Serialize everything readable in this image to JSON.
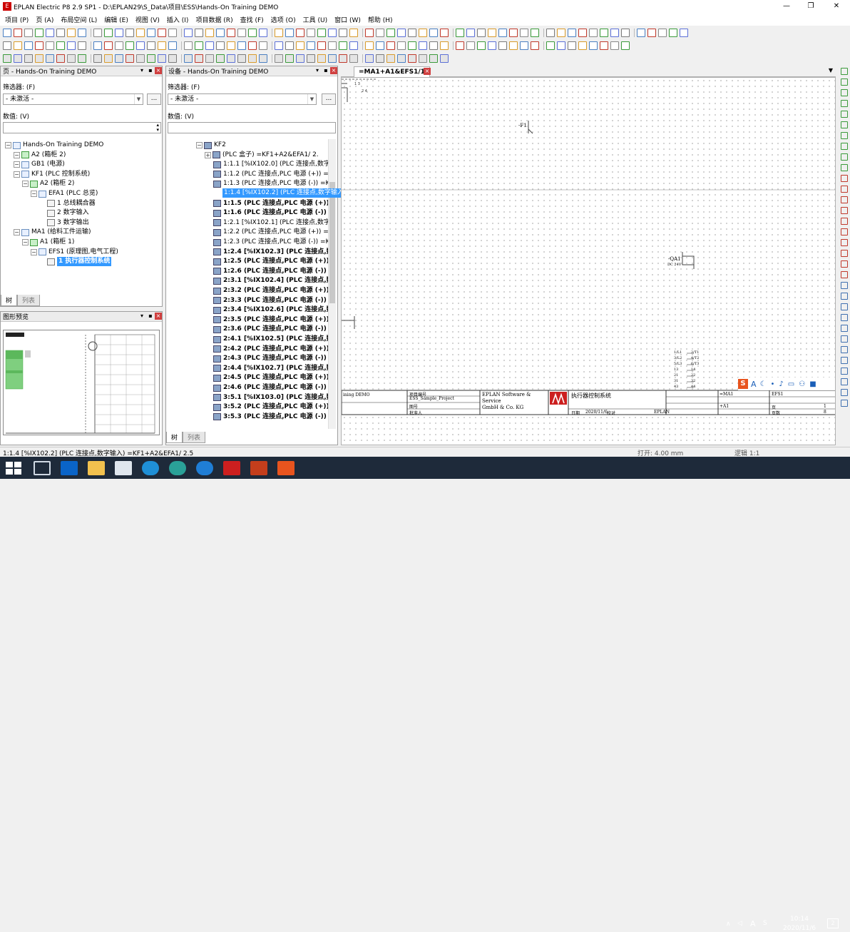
{
  "window": {
    "title": "EPLAN Electric P8 2.9 SP1 - D:\\EPLAN29\\S_Data\\项目\\ESS\\Hands-On Training DEMO",
    "minimize": "—",
    "maximize": "❐",
    "close": "✕"
  },
  "menu": [
    "项目 (P)",
    "页 (A)",
    "布局空间 (L)",
    "编辑 (E)",
    "视图 (V)",
    "插入 (I)",
    "项目数据 (R)",
    "查找 (F)",
    "选项 (O)",
    "工具 (U)",
    "窗口 (W)",
    "帮助 (H)"
  ],
  "page_panel": {
    "title": "页 - Hands-On Training DEMO",
    "filter_label": "筛选器: (F)",
    "filter_value": "- 未激活 -",
    "value_label": "数值: (V)",
    "more_button": "...",
    "tree": [
      {
        "label": "Hands-On Training DEMO",
        "level": 0,
        "icon": "project-icon"
      },
      {
        "label": "A2 (箱柜 2)",
        "level": 1,
        "icon": "cabinet-icon"
      },
      {
        "label": "GB1 (电源)",
        "level": 1,
        "icon": "power-icon"
      },
      {
        "label": "KF1 (PLC 控制系统)",
        "level": 1,
        "icon": "plc-icon"
      },
      {
        "label": "A2 (箱柜 2)",
        "level": 2,
        "icon": "cabinet-icon"
      },
      {
        "label": "EFA1 (PLC 总览)",
        "level": 3,
        "icon": "folder-icon"
      },
      {
        "label": "1 总线耦合器",
        "level": 4,
        "icon": "page-icon"
      },
      {
        "label": "2 数字输入",
        "level": 4,
        "icon": "page-icon"
      },
      {
        "label": "3 数字输出",
        "level": 4,
        "icon": "page-icon"
      },
      {
        "label": "MA1 (给料工件运输)",
        "level": 1,
        "icon": "folder-icon"
      },
      {
        "label": "A1 (箱柜 1)",
        "level": 2,
        "icon": "cabinet-icon"
      },
      {
        "label": "EFS1 (原理图,电气工程)",
        "level": 3,
        "icon": "folder-icon"
      },
      {
        "label": "1 执行器控制系统",
        "level": 4,
        "icon": "page-icon",
        "bold": true,
        "selected": true
      }
    ],
    "tabs": [
      "树",
      "列表"
    ]
  },
  "preview_panel": {
    "title": "图形预览"
  },
  "device_panel": {
    "title": "设备 - Hands-On Training DEMO",
    "filter_label": "筛选器: (F)",
    "filter_value": "- 未激活 -",
    "value_label": "数值: (V)",
    "more_button": "...",
    "tree": [
      {
        "label": "KF2",
        "level": 0,
        "bold": false
      },
      {
        "label": "(PLC 盒子) =KF1+A2&EFA1/ 2.",
        "level": 1
      },
      {
        "label": "1:1.1  [%IX102.0] (PLC 连接点,数字",
        "level": 2
      },
      {
        "label": "1:1.2 (PLC 连接点,PLC 电源 (+)) =I",
        "level": 2
      },
      {
        "label": "1:1.3 (PLC 连接点,PLC 电源 (-)) =K",
        "level": 2
      },
      {
        "label": "1:1.4  [%IX102.2] (PLC 连接点,数字输入) =KF1+A2&EFA1/ 2.5",
        "level": 2,
        "selected": true
      },
      {
        "label": "1:1.5 (PLC 连接点,PLC 电源 (+)) =",
        "level": 2,
        "bold": true
      },
      {
        "label": "1:1.6 (PLC 连接点,PLC 电源 (-)) =",
        "level": 2,
        "bold": true
      },
      {
        "label": "1:2.1  [%IX102.1] (PLC 连接点,数字",
        "level": 2
      },
      {
        "label": "1:2.2 (PLC 连接点,PLC 电源 (+)) =I",
        "level": 2
      },
      {
        "label": "1:2.3 (PLC 连接点,PLC 电源 (-)) =K",
        "level": 2
      },
      {
        "label": "1:2.4  [%IX102.3] (PLC 连接点,数'",
        "level": 2,
        "bold": true
      },
      {
        "label": "1:2.5 (PLC 连接点,PLC 电源 (+)) =",
        "level": 2,
        "bold": true
      },
      {
        "label": "1:2.6 (PLC 连接点,PLC 电源 (-)) =",
        "level": 2,
        "bold": true
      },
      {
        "label": "2:3.1  [%IX102.4] (PLC 连接点,数'",
        "level": 2,
        "bold": true
      },
      {
        "label": "2:3.2 (PLC 连接点,PLC 电源 (+)) =",
        "level": 2,
        "bold": true
      },
      {
        "label": "2:3.3 (PLC 连接点,PLC 电源 (-)) =",
        "level": 2,
        "bold": true
      },
      {
        "label": "2:3.4  [%IX102.6] (PLC 连接点,数'",
        "level": 2,
        "bold": true
      },
      {
        "label": "2:3.5 (PLC 连接点,PLC 电源 (+)) =",
        "level": 2,
        "bold": true
      },
      {
        "label": "2:3.6 (PLC 连接点,PLC 电源 (-)) =",
        "level": 2,
        "bold": true
      },
      {
        "label": "2:4.1  [%IX102.5] (PLC 连接点,数'",
        "level": 2,
        "bold": true
      },
      {
        "label": "2:4.2 (PLC 连接点,PLC 电源 (+)) =",
        "level": 2,
        "bold": true
      },
      {
        "label": "2:4.3 (PLC 连接点,PLC 电源 (-)) =",
        "level": 2,
        "bold": true
      },
      {
        "label": "2:4.4  [%IX102.7] (PLC 连接点,数'",
        "level": 2,
        "bold": true
      },
      {
        "label": "2:4.5 (PLC 连接点,PLC 电源 (+)) =",
        "level": 2,
        "bold": true
      },
      {
        "label": "2:4.6 (PLC 连接点,PLC 电源 (-)) =",
        "level": 2,
        "bold": true
      },
      {
        "label": "3:5.1  [%IX103.0] (PLC 连接点,数'",
        "level": 2,
        "bold": true
      },
      {
        "label": "3:5.2 (PLC 连接点,PLC 电源 (+)) =",
        "level": 2,
        "bold": true
      },
      {
        "label": "3:5.3 (PLC 连接点,PLC 电源 (-)) =",
        "level": 2,
        "bold": true
      }
    ],
    "tabs": [
      "树",
      "列表"
    ]
  },
  "document": {
    "tab": "=MA1+A1&EFS1/1",
    "labels": {
      "f1": "-F1",
      "qa1": "-QA1",
      "qa1_sub": "DC 24V"
    },
    "titleblock": {
      "left": "ining DEMO",
      "proj_label": "项目编号",
      "proj_value": "ESS_Sample_Project",
      "drawn_label": "图号",
      "checked_label": "批准人",
      "company1": "EPLAN Software &",
      "company2": "Service",
      "company3": "GmbH & Co. KG",
      "logo": "EPLAN",
      "page_title": "执行器控制系统",
      "date_label": "日期",
      "date_value": "2020/11/6",
      "by_label": "校对",
      "by_value": "EPLAN",
      "r1": "=MA1",
      "r2": "+A1",
      "r3": "EFS1",
      "page_label": "页",
      "page_value": "1",
      "pages_label": "页数",
      "pages_value": "8"
    },
    "contacts": [
      "1/L1",
      "3/L2",
      "5/L3",
      "13",
      "21",
      "31",
      "43",
      "2/T1",
      "4/T2",
      "6/T3",
      "14",
      "22",
      "32",
      "44"
    ]
  },
  "status": {
    "left": "1:1.4  [%IX102.2] (PLC 连接点,数字输入) =KF1+A2&EFA1/ 2.5",
    "open": "打开: 4.00 mm",
    "logic": "逻辑 1:1"
  },
  "taskbar": {
    "time": "10:14",
    "date": "2020/11/6",
    "ime": "A",
    "notif": "2"
  },
  "colors": {
    "selection": "#3399ff",
    "taskbar": "#1e2a3a",
    "eplan_red": "#cc1f1f"
  }
}
